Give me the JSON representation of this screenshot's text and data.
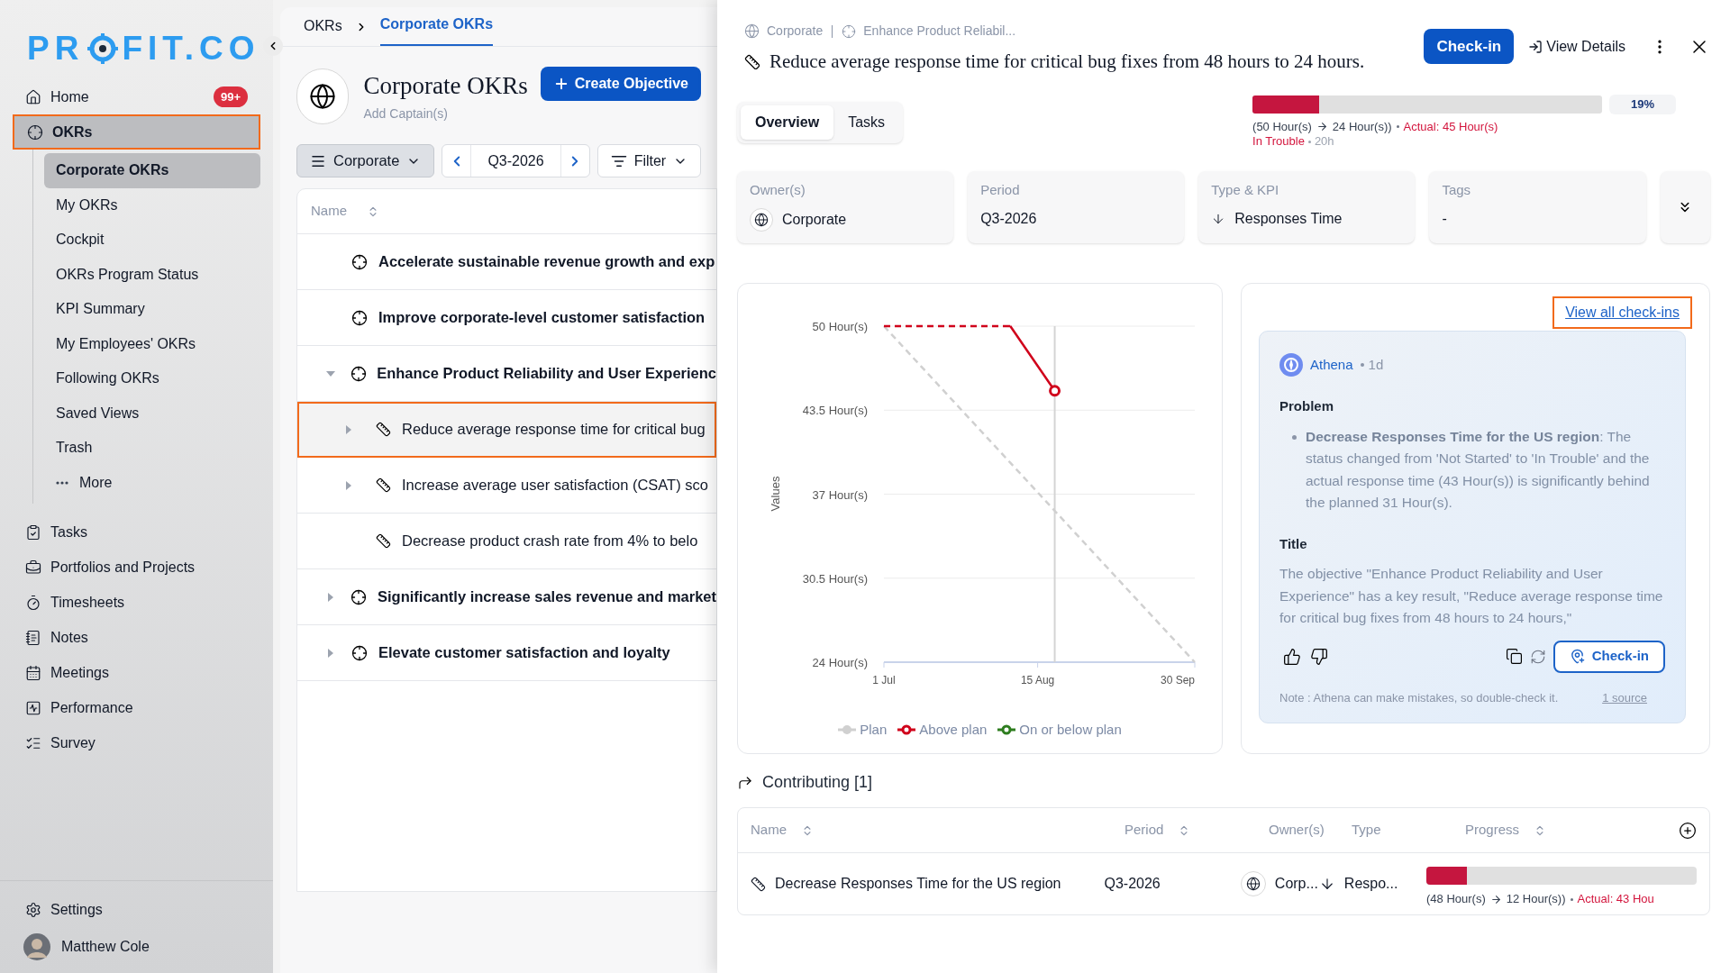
{
  "sidebar": {
    "logo": {
      "before": "PR",
      "after": "FIT.CO"
    },
    "items": [
      {
        "label": "Home",
        "selected": false,
        "badge": "99+"
      },
      {
        "label": "OKRs",
        "selected": true,
        "children": [
          {
            "label": "Corporate OKRs",
            "kind": "link",
            "selected": true
          },
          {
            "label": "My OKRs",
            "kind": "link",
            "selected": false
          },
          {
            "label": "Cockpit",
            "kind": "link",
            "selected": false
          },
          {
            "label": "OKRs Program Status",
            "kind": "link",
            "selected": false
          },
          {
            "label": "KPI Summary",
            "kind": "link",
            "selected": false
          },
          {
            "label": "My Employees' OKRs",
            "kind": "link",
            "selected": false
          },
          {
            "label": "Following OKRs",
            "kind": "link",
            "selected": false
          },
          {
            "label": "Saved Views",
            "kind": "link",
            "selected": false
          },
          {
            "label": "Trash",
            "kind": "link",
            "selected": false
          },
          {
            "label": "More",
            "kind": "more",
            "selected": false
          }
        ]
      },
      {
        "label": "Tasks",
        "selected": false
      },
      {
        "label": "Portfolios and Projects",
        "selected": false
      },
      {
        "label": "Timesheets",
        "selected": false
      },
      {
        "label": "Notes",
        "selected": false
      },
      {
        "label": "Meetings",
        "selected": false
      },
      {
        "label": "Performance",
        "selected": false
      },
      {
        "label": "Survey",
        "selected": false
      }
    ],
    "settings": "Settings",
    "user": "Matthew Cole"
  },
  "okrs_page": {
    "breadcrumb": [
      {
        "label": "OKRs",
        "selected": false
      },
      {
        "label": "Corporate OKRs",
        "selected": true
      }
    ],
    "title": "Corporate OKRs",
    "subtitle": "Add Captain(s)",
    "create_button": "Create Objective",
    "scope_dropdown": "Corporate",
    "period": "Q3-2026",
    "filter_button": "Filter",
    "table": {
      "columns": [
        "Name"
      ],
      "rows": [
        {
          "kind": "objective",
          "name": "Accelerate sustainable revenue growth and exp",
          "expandable": false,
          "selected": false
        },
        {
          "kind": "objective",
          "name": "Improve corporate-level customer satisfaction",
          "expandable": false,
          "selected": false
        },
        {
          "kind": "objective",
          "name": "Enhance Product Reliability and User Experienc",
          "expandable": true,
          "expanded": true,
          "selected": false,
          "children": [
            {
              "kind": "key_result",
              "name": "Reduce average response time for critical bug",
              "expandable": true,
              "expanded": false,
              "selected": true
            },
            {
              "kind": "key_result",
              "name": "Increase average user satisfaction (CSAT) sco",
              "expandable": true,
              "expanded": false,
              "selected": false
            },
            {
              "kind": "key_result",
              "name": "Decrease product crash rate from 4% to belo",
              "expandable": false,
              "selected": false
            }
          ]
        },
        {
          "kind": "objective",
          "name": "Significantly increase sales revenue and market",
          "expandable": true,
          "expanded": false,
          "selected": false
        },
        {
          "kind": "objective",
          "name": "Elevate customer satisfaction and loyalty",
          "expandable": true,
          "expanded": false,
          "selected": false
        }
      ]
    }
  },
  "detail": {
    "breadcrumb": [
      "Corporate",
      "Enhance Product Reliabil..."
    ],
    "title": "Reduce average response time for critical bug fixes from 48 hours to 24 hours.",
    "checkin_button": "Check-in",
    "view_details": "View Details",
    "tabs": [
      {
        "label": "Overview",
        "selected": true
      },
      {
        "label": "Tasks",
        "selected": false
      }
    ],
    "progress": {
      "level": 0.19,
      "percent": "19%",
      "start": "(50 Hour(s)",
      "target": "24 Hour(s))",
      "actual": "Actual: 45 Hour(s)",
      "status": "In Trouble",
      "age": "20h"
    },
    "info": [
      {
        "kind": "owner",
        "label": "Owner(s)",
        "value": "Corporate"
      },
      {
        "kind": "text",
        "label": "Period",
        "value": "Q3-2026"
      },
      {
        "kind": "kpi",
        "label": "Type & KPI",
        "value": "Responses Time"
      },
      {
        "kind": "text",
        "label": "Tags",
        "value": "-"
      }
    ],
    "chart_data": {
      "type": "line",
      "ylabel": "Values",
      "x": [
        "2026-07-01",
        "2026-08-07",
        "2026-08-20",
        "2026-09-30"
      ],
      "series": [
        {
          "name": "Plan",
          "color": "#d0d0d0",
          "line_style": "dashed",
          "values": [
            50,
            39.43,
            35.71,
            24
          ]
        },
        {
          "name": "Above plan",
          "color": "#d0021b",
          "line_style": "dashed-then-solid",
          "values": [
            50,
            50,
            45,
            null
          ]
        },
        {
          "name": "On or below plan",
          "color": "#2e7d1f",
          "values": [
            null,
            null,
            null,
            null
          ]
        }
      ],
      "xlim": [
        "2026-07-01",
        "2026-09-30"
      ],
      "ylim": [
        24,
        50
      ],
      "xticks": [
        {
          "value": "2026-07-01",
          "label": "1 Jul"
        },
        {
          "value": "2026-08-15",
          "label": "15 Aug"
        },
        {
          "value": "2026-09-30",
          "label": "30 Sep"
        }
      ],
      "yticks": [
        {
          "value": 24,
          "label": "24 Hour(s)"
        },
        {
          "value": 30.5,
          "label": "30.5 Hour(s)"
        },
        {
          "value": 37,
          "label": "37 Hour(s)"
        },
        {
          "value": 43.5,
          "label": "43.5 Hour(s)"
        },
        {
          "value": 50,
          "label": "50 Hour(s)"
        }
      ],
      "grid": true,
      "legend": true,
      "ref_lines": [
        {
          "axis": "x",
          "value": "2026-08-20"
        }
      ]
    },
    "checkins": {
      "link": "View all check-ins",
      "author": "Athena",
      "age": "1d",
      "sections": [
        {
          "kind": "bullets",
          "heading": "Problem",
          "items": [
            "**Decrease Responses Time for the US region**: The status changed from 'Not Started' to 'In Trouble' and the actual response time (43 Hour(s)) is significantly behind the planned 31 Hour(s)."
          ]
        },
        {
          "kind": "paragraph",
          "heading": "Title",
          "text": "The objective \"Enhance Product Reliability and User Experience\" has a key result, \"Reduce average response time for critical bug fixes from 48 hours to 24 hours,\""
        }
      ],
      "checkin_button": "Check-in",
      "note": "Note : Athena can make mistakes, so double-check it.",
      "source": "1 source"
    },
    "contributing": {
      "title": "Contributing [1]",
      "columns": [
        {
          "label": "Name",
          "sortable": true
        },
        {
          "label": "Period",
          "sortable": true
        },
        {
          "label": "Owner(s)",
          "sortable": false
        },
        {
          "label": "Type",
          "sortable": false
        },
        {
          "label": "Progress",
          "sortable": true
        }
      ],
      "rows": [
        {
          "name": "Decrease Responses Time for the US region",
          "period": "Q3-2026",
          "owner": "Corp...",
          "type": "Respo...",
          "progress": {
            "level": 0.15,
            "start": "(48 Hour(s)",
            "target": "12 Hour(s))",
            "actual": "Actual: 43 Hou"
          }
        }
      ]
    }
  }
}
